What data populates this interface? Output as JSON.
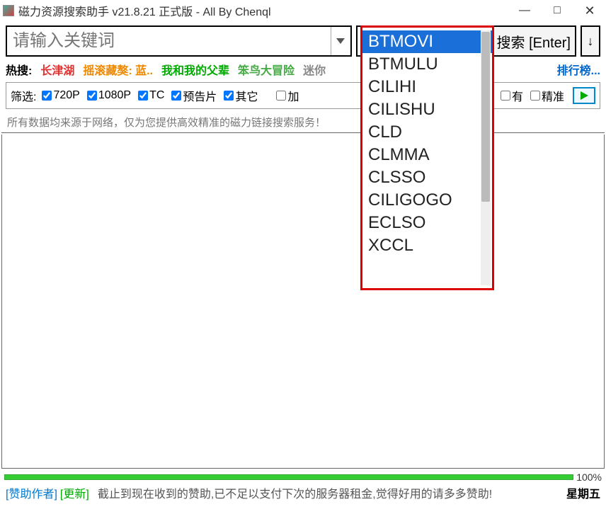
{
  "window": {
    "title": "磁力资源搜索助手 v21.8.21 正式版 - All By Chenql"
  },
  "search": {
    "placeholder": "请输入关键词",
    "button": "搜索 [Enter]"
  },
  "source": {
    "selected": "BTMOVI",
    "options": [
      "BTMOVI",
      "BTMULU",
      "CILIHI",
      "CILISHU",
      "CLD",
      "CLMMA",
      "CLSSO",
      "CILIGOGO",
      "ECLSO",
      "XCCL"
    ]
  },
  "hot": {
    "label": "热搜:",
    "items": [
      "长津湖",
      "摇滚藏獒: 蓝..",
      "我和我的父辈",
      "笨鸟大冒险",
      "迷你"
    ],
    "rank": "排行榜..."
  },
  "filter": {
    "label": "筛选:",
    "opts": {
      "p720": "720P",
      "p1080": "1080P",
      "tc": "TC",
      "trailer": "预告片",
      "other": "其它",
      "append": "加",
      "has": "有",
      "precise": "精准"
    }
  },
  "info": "所有数据均来源于网络，仅为您提供高效精准的磁力链接搜索服务！",
  "progress": {
    "pct": "100%"
  },
  "status": {
    "sponsor": "[赞助作者]",
    "update": "[更新]",
    "msg": "截止到现在收到的赞助,已不足以支付下次的服务器租金,觉得好用的请多多赞助!",
    "day": "星期五"
  }
}
